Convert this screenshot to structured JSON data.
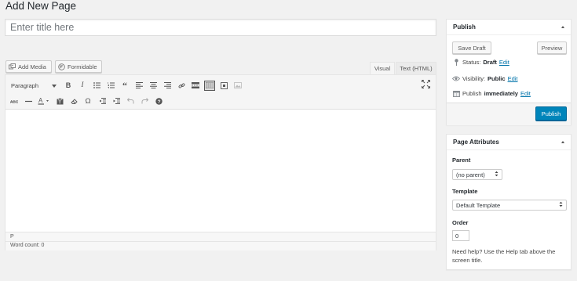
{
  "page": {
    "title": "Add New Page"
  },
  "title_field": {
    "placeholder": "Enter title here",
    "value": ""
  },
  "media_buttons": {
    "add_media": "Add Media",
    "formidable": "Formidable"
  },
  "editor_tabs": {
    "visual": "Visual",
    "text": "Text (HTML)"
  },
  "toolbar": {
    "format_select": "Paragraph",
    "row1": [
      "bold-icon",
      "italic-icon",
      "bullet-list-icon",
      "numbered-list-icon",
      "blockquote-icon",
      "align-left-icon",
      "align-center-icon",
      "align-right-icon",
      "link-icon",
      "read-more-icon",
      "toolbar-toggle-icon",
      "formidable-icon",
      "insert-media-icon"
    ],
    "row2": [
      "strikethrough-icon",
      "horizontal-line-icon",
      "text-color-icon",
      "paste-text-icon",
      "clear-formatting-icon",
      "special-character-icon",
      "outdent-icon",
      "indent-icon",
      "undo-icon",
      "redo-icon",
      "help-icon"
    ],
    "glyphs": {
      "bold": "B",
      "italic": "I",
      "quote": "“",
      "omega": "Ω",
      "help": "?",
      "text_color": "A"
    }
  },
  "editor": {
    "content": "",
    "path": "P",
    "word_count": "Word count: 0"
  },
  "publish_box": {
    "title": "Publish",
    "save_draft": "Save Draft",
    "preview": "Preview",
    "status_label": "Status:",
    "status_value": "Draft",
    "visibility_label": "Visibility:",
    "visibility_value": "Public",
    "publish_label": "Publish",
    "publish_value": "immediately",
    "edit_link": "Edit",
    "publish_button": "Publish"
  },
  "page_attributes": {
    "title": "Page Attributes",
    "parent_label": "Parent",
    "parent_value": "(no parent)",
    "template_label": "Template",
    "template_value": "Default Template",
    "order_label": "Order",
    "order_value": "0",
    "help_text": "Need help? Use the Help tab above the screen title."
  },
  "colors": {
    "accent": "#0085ba",
    "link": "#0073aa",
    "background": "#f1f1f1"
  }
}
